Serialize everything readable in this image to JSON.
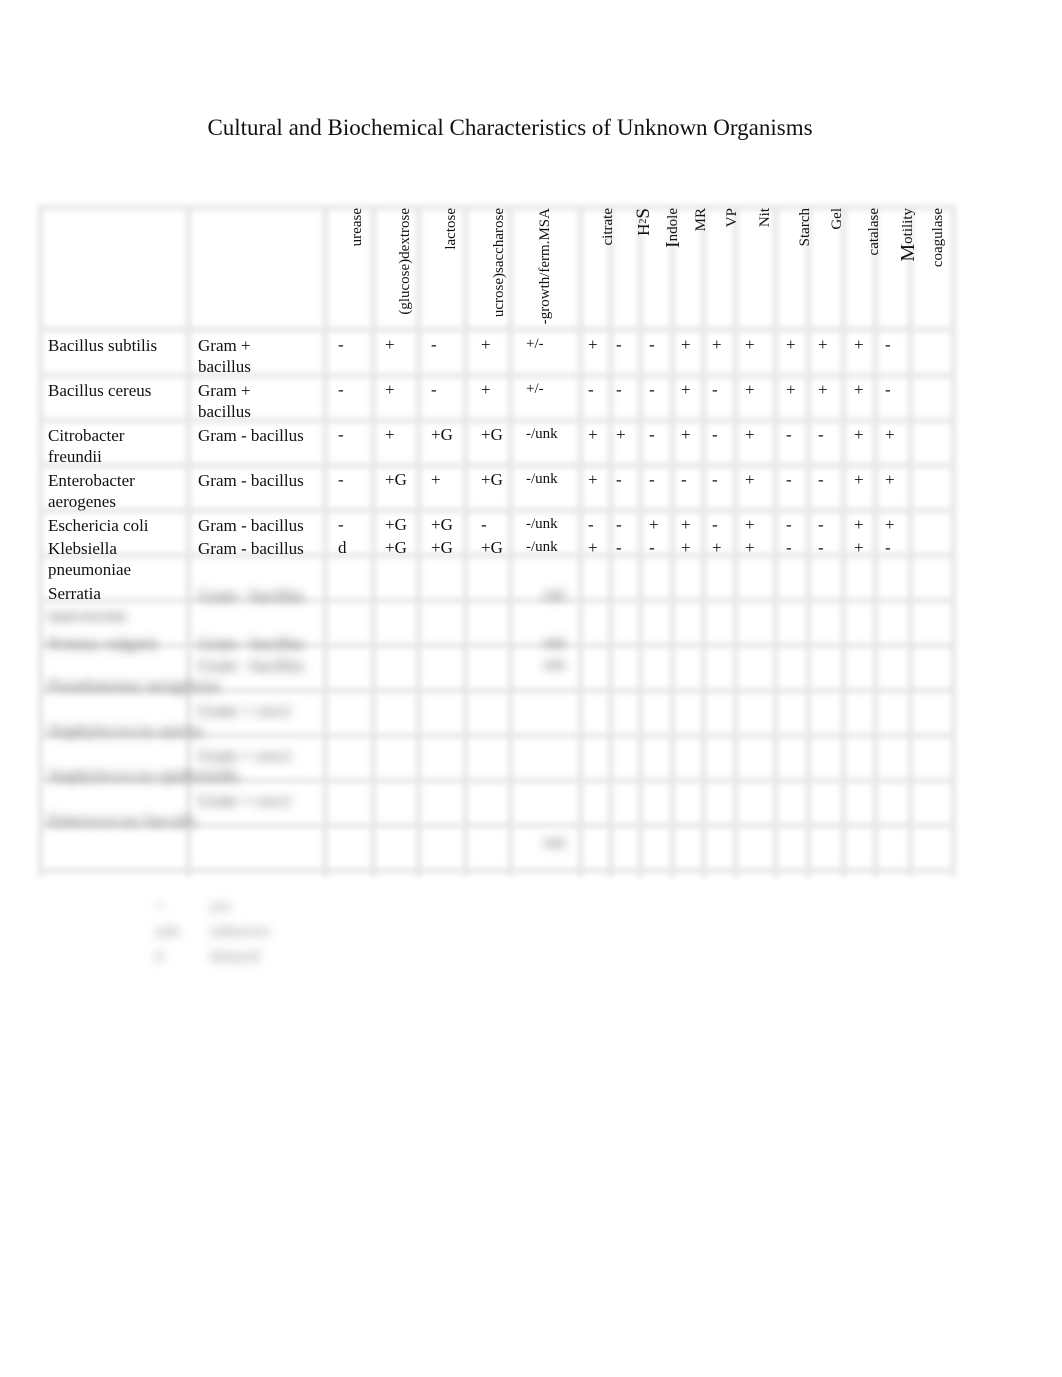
{
  "title": "Cultural and Biochemical Characteristics of Unknown Organisms",
  "columns": [
    "urease",
    "(glucose)dextrose",
    "lactose",
    "(sucrose)saccharose",
    "growth/ferm.MSA",
    "citrate",
    "H2S",
    "Indole",
    "MR",
    "VP",
    "Nit",
    "Starch",
    "Gel",
    "catalase",
    "Motility",
    "coagulase"
  ],
  "header_labels": {
    "urease": "urease",
    "dextrose": "(glucose)dextrose",
    "lactose": "lactose",
    "sucrose": "ucrose)saccharose",
    "msa": "-growth/ferm.MSA",
    "citrate": "citrate",
    "h2s_main": "H",
    "h2s_sub": "2",
    "h2s_end": "S",
    "indole": "Indole",
    "mr": "MR",
    "vp": "VP",
    "nit": "Nit",
    "starch": "Starch",
    "gel": "Gel",
    "catalase": "catalase",
    "motility": "Motility",
    "coagulase": "coagulase"
  },
  "rows": [
    {
      "organism": [
        "Bacillus subtilis"
      ],
      "gram": [
        "Gram +",
        "bacillus"
      ],
      "values": [
        "-",
        "+",
        "-",
        "+",
        "+/-",
        "+",
        "-",
        "-",
        "+",
        "+",
        "+",
        "+",
        "+",
        "+",
        "-",
        ""
      ]
    },
    {
      "organism": [
        "Bacillus cereus"
      ],
      "gram": [
        "Gram +",
        "bacillus"
      ],
      "values": [
        "-",
        "+",
        "-",
        "+",
        "+/-",
        "-",
        "-",
        "-",
        "+",
        "-",
        "+",
        "+",
        "+",
        "+",
        "-",
        ""
      ]
    },
    {
      "organism": [
        "Citrobacter",
        "freundii"
      ],
      "gram": [
        "Gram - bacillus"
      ],
      "values": [
        "-",
        "+",
        "+G",
        "+G",
        "-/unk",
        "+",
        "+",
        "-",
        "+",
        "-",
        "+",
        "-",
        "-",
        "+",
        "+",
        ""
      ]
    },
    {
      "organism": [
        "Enterobacter",
        "aerogenes"
      ],
      "gram": [
        "Gram - bacillus"
      ],
      "values": [
        "-",
        "+G",
        "+",
        "+G",
        "-/unk",
        "+",
        "-",
        "-",
        "-",
        "-",
        "+",
        "-",
        "-",
        "+",
        "+",
        ""
      ]
    },
    {
      "organism": [
        "Eschericia coli"
      ],
      "gram": [
        "Gram - bacillus"
      ],
      "values": [
        "-",
        "+G",
        "+G",
        "-",
        "-/unk",
        "-",
        "-",
        "+",
        "+",
        "-",
        "+",
        "-",
        "-",
        "+",
        "+",
        ""
      ]
    },
    {
      "organism": [
        "Klebsiella",
        "pneumoniae"
      ],
      "gram": [
        "Gram - bacillus"
      ],
      "values": [
        "d",
        "+G",
        "+G",
        "+G",
        "-/unk",
        "+",
        "-",
        "-",
        "+",
        "+",
        "+",
        "-",
        "-",
        "+",
        "-",
        ""
      ]
    },
    {
      "organism": [
        "Serratia"
      ],
      "gram": [],
      "values": []
    }
  ],
  "blurred_rows": [
    {
      "organism": "marcescens",
      "gram": "Gram - bacillus",
      "msa": "unk"
    },
    {
      "organism": "Proteus vulgaris",
      "gram": "Gram - bacillus",
      "msa": "unk"
    },
    {
      "organism": "Pseudomonas aeruginosa",
      "gram": "Gram - bacillus",
      "msa": "unk"
    },
    {
      "organism": "Staphylococcus aureus",
      "gram": "Gram + cocci",
      "msa": ""
    },
    {
      "organism": "Staphylococcus epidermidis",
      "gram": "Gram + cocci",
      "msa": ""
    },
    {
      "organism": "Enterococcus faecalis",
      "gram": "Gram + cocci",
      "msa": "unk"
    }
  ],
  "legend": [
    {
      "key": "+",
      "text": "yes"
    },
    {
      "key": "unk",
      "text": "unknown"
    },
    {
      "key": "d",
      "text": "delayed"
    }
  ]
}
